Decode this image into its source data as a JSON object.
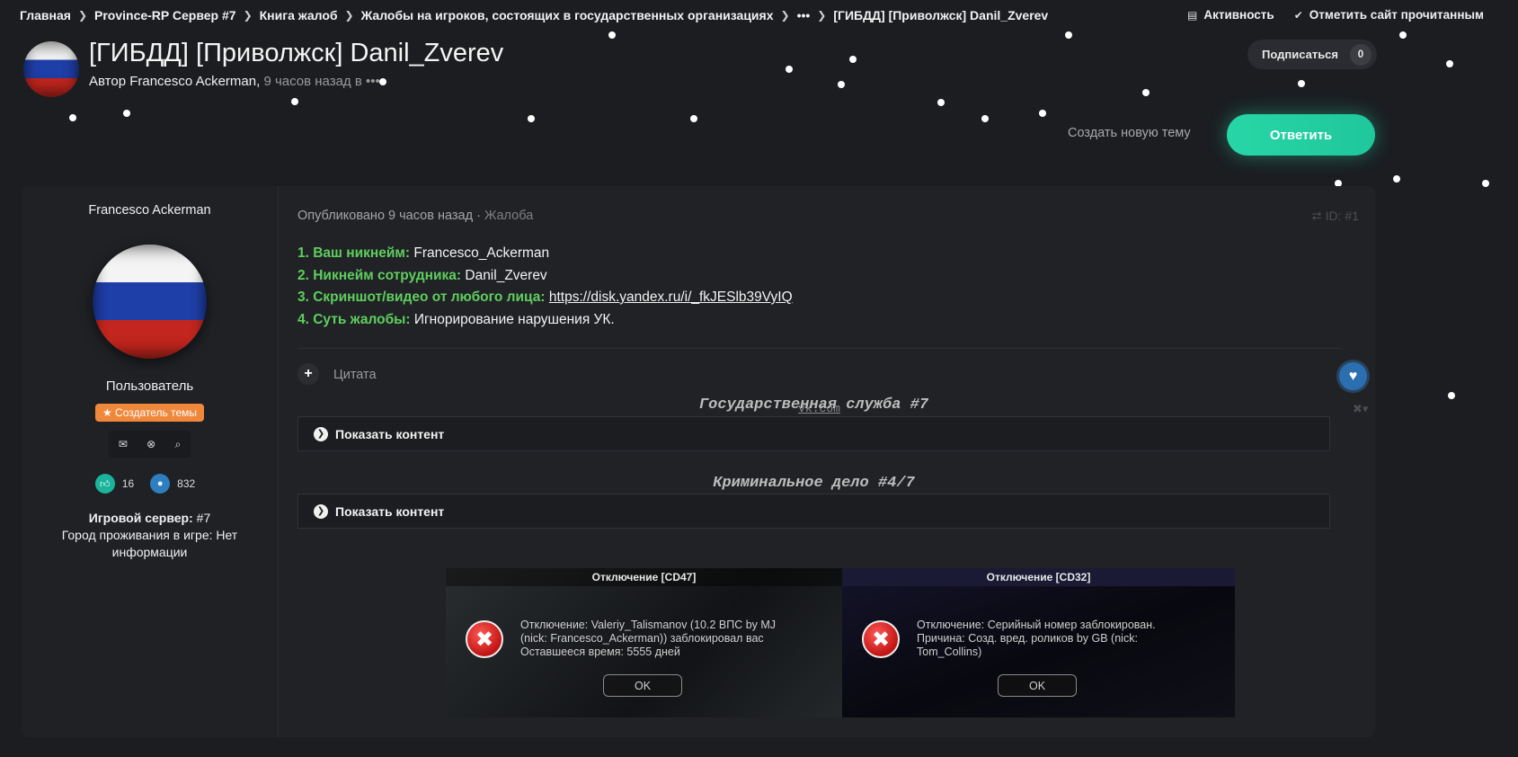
{
  "breadcrumb": [
    "Главная",
    "Province-RP Сервер #7",
    "Книга жалоб",
    "Жалобы на игроков, состоящих в государственных организациях",
    "•••",
    "[ГИБДД] [Приволжск] Danil_Zverev"
  ],
  "top_actions": {
    "activity": "Активность",
    "mark_read": "Отметить сайт прочитанным"
  },
  "topic": {
    "title": "[ГИБДД] [Приволжск] Danil_Zverev",
    "author_prefix": "Автор",
    "author": "Francesco Ackerman",
    "time": "9 часов назад в",
    "ellipsis": "•••"
  },
  "subscribe": {
    "label": "Подписаться",
    "count": "0"
  },
  "buttons": {
    "new_topic": "Создать новую тему",
    "reply": "Ответить"
  },
  "user": {
    "name": "Francesco Ackerman",
    "role": "Пользователь",
    "badge": "Создатель темы",
    "likes": "16",
    "posts": "832",
    "server_label": "Игровой сервер:",
    "server_value": "#7",
    "city": "Город проживания в игре: Нет информации"
  },
  "post": {
    "published": "Опубликовано 9 часов назад",
    "category": "Жалоба",
    "id": "ID: #1",
    "fields": [
      {
        "label": "1. Ваш никнейм:",
        "value": "Francesco_Ackerman"
      },
      {
        "label": "2. Никнейм сотрудника:",
        "value": "Danil_Zverev"
      },
      {
        "label": "3. Скриншот/видео от любого лица:",
        "value": "https://disk.yandex.ru/i/_fkJESlb39VyIQ"
      },
      {
        "label": "4. Суть жалобы:",
        "value": "Игнорирование нарушения УК."
      }
    ],
    "quote": "Цитата"
  },
  "signature": {
    "vk": "vk.com",
    "section1": "Государственная служба #7",
    "section2": "Криминальное дело #4/7",
    "spoiler": "Показать контент"
  },
  "dialogs": [
    {
      "title": "Отключение [CD47]",
      "text": "Отключение: Valeriy_Talismanov (10.2 ВПС by MJ\n(nick: Francesco_Ackerman)) заблокировал вас\nОставшееся время: 5555 дней",
      "ok": "OK"
    },
    {
      "title": "Отключение [CD32]",
      "text": "Отключение: Серийный номер заблокирован.\nПричина: Созд. вред. роликов by GB (nick:\nTom_Collins)",
      "ok": "OK"
    }
  ],
  "icons": {
    "activity": "activity-icon",
    "check": "check-icon",
    "mail": "mail-icon",
    "block": "block-icon",
    "search": "search-icon",
    "heart": "heart-icon",
    "share": "share-icon"
  },
  "colors": {
    "background": "#1b1d21",
    "card": "#202226",
    "accent": "#27d6a6",
    "label_green": "#5fce5e",
    "badge": "#f0883c",
    "heart": "#2b6fb0"
  }
}
